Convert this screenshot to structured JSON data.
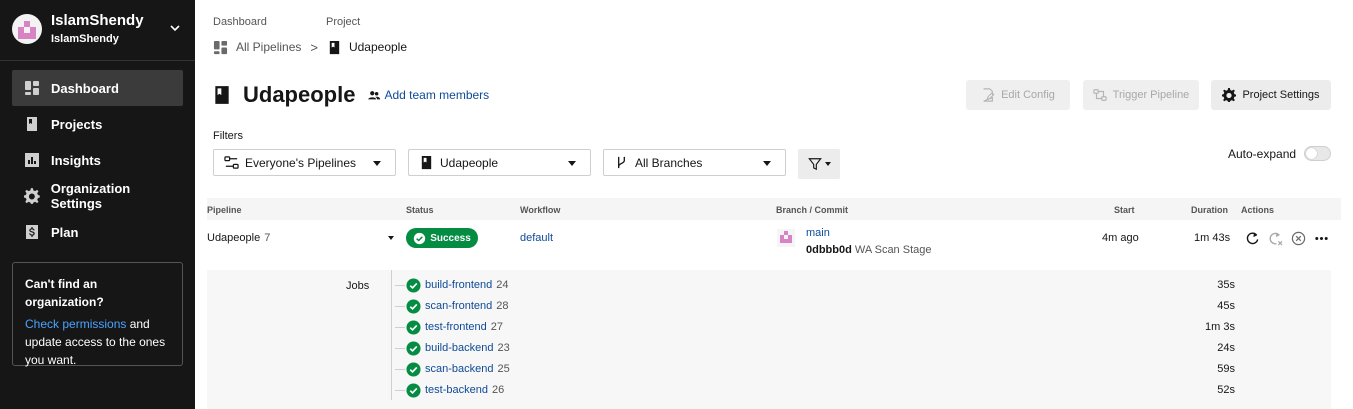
{
  "sidebar": {
    "org_name": "IslamShendy",
    "org_sub": "IslamShendy",
    "nav": [
      {
        "label": "Dashboard",
        "icon": "dashboard-icon",
        "active": true
      },
      {
        "label": "Projects",
        "icon": "project-icon",
        "active": false
      },
      {
        "label": "Insights",
        "icon": "insights-icon",
        "active": false
      },
      {
        "label": "Organization Settings",
        "icon": "gear-icon",
        "active": false
      },
      {
        "label": "Plan",
        "icon": "dollar-icon",
        "active": false
      }
    ],
    "help": {
      "title": "Can't find an organization?",
      "link": "Check permissions",
      "text": " and update access to the ones you want."
    }
  },
  "breadcrumb": {
    "label_dashboard": "Dashboard",
    "label_project": "Project",
    "all_pipelines": "All Pipelines",
    "separator": ">",
    "project": "Udapeople"
  },
  "header": {
    "title": "Udapeople",
    "add_team": "Add team members",
    "edit_config": "Edit Config",
    "trigger_pipeline": "Trigger Pipeline",
    "project_settings": "Project Settings"
  },
  "filters": {
    "label": "Filters",
    "pipelines": "Everyone's Pipelines",
    "project": "Udapeople",
    "branch": "All Branches",
    "auto_expand": "Auto-expand",
    "auto_expand_on": false
  },
  "table": {
    "columns": {
      "pipeline": "Pipeline",
      "status": "Status",
      "workflow": "Workflow",
      "branch_commit": "Branch / Commit",
      "start": "Start",
      "duration": "Duration",
      "actions": "Actions"
    },
    "row": {
      "pipeline": "Udapeople",
      "number": "7",
      "status": "Success",
      "workflow": "default",
      "branch": "main",
      "commit_hash": "0dbbb0d",
      "commit_msg": "WA Scan Stage",
      "start": "4m ago",
      "duration": "1m 43s"
    },
    "jobs_label": "Jobs",
    "jobs": [
      {
        "name": "build-frontend",
        "number": "24",
        "duration": "35s"
      },
      {
        "name": "scan-frontend",
        "number": "28",
        "duration": "45s"
      },
      {
        "name": "test-frontend",
        "number": "27",
        "duration": "1m 3s"
      },
      {
        "name": "build-backend",
        "number": "23",
        "duration": "24s"
      },
      {
        "name": "scan-backend",
        "number": "25",
        "duration": "59s"
      },
      {
        "name": "test-backend",
        "number": "26",
        "duration": "52s"
      }
    ]
  },
  "colors": {
    "sidebar_bg": "#161616",
    "success": "#048c43",
    "link": "#0e4a97",
    "avatar_pink": "#d884c4"
  }
}
